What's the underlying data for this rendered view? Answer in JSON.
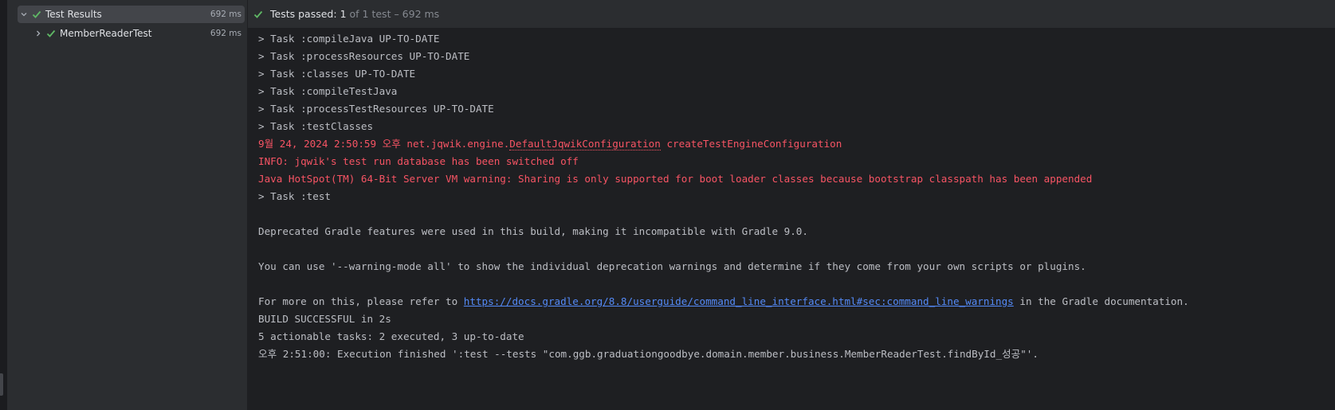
{
  "colors": {
    "pass_green": "#5fb865",
    "error_red": "#f75464",
    "link_blue": "#548af7"
  },
  "tree": {
    "root": {
      "label": "Test Results",
      "time": "692 ms",
      "icon": "check-icon",
      "expanded": true
    },
    "items": [
      {
        "label": "MemberReaderTest",
        "time": "692 ms",
        "icon": "check-icon",
        "expanded": false
      }
    ]
  },
  "status_bar": {
    "prefix": "Tests passed:",
    "passed": "1",
    "suffix": "of 1 test – 692 ms"
  },
  "console": {
    "line1": "> Task :compileJava UP-TO-DATE",
    "line2": "> Task :processResources UP-TO-DATE",
    "line3": "> Task :classes UP-TO-DATE",
    "line4": "> Task :compileTestJava",
    "line5": "> Task :processTestResources UP-TO-DATE",
    "line6": "> Task :testClasses",
    "line7_prefix": "9월 24, 2024 2:50:59 오후 net.jqwik.engine.",
    "line7_class": "DefaultJqwikConfiguration",
    "line7_suffix": " createTestEngineConfiguration",
    "line8": "INFO: jqwik's test run database has been switched off",
    "line9": "Java HotSpot(TM) 64-Bit Server VM warning: Sharing is only supported for boot loader classes because bootstrap classpath has been appended",
    "line10": "> Task :test",
    "line12": "Deprecated Gradle features were used in this build, making it incompatible with Gradle 9.0.",
    "line14": "You can use '--warning-mode all' to show the individual deprecation warnings and determine if they come from your own scripts or plugins.",
    "line16_prefix": "For more on this, please refer to ",
    "line16_link": "https://docs.gradle.org/8.8/userguide/command_line_interface.html#sec:command_line_warnings",
    "line16_suffix": " in the Gradle documentation.",
    "line17": "BUILD SUCCESSFUL in 2s",
    "line18": "5 actionable tasks: 2 executed, 3 up-to-date",
    "line19": "오후 2:51:00: Execution finished ':test --tests \"com.ggb.graduationgoodbye.domain.member.business.MemberReaderTest.findById_성공\"'."
  }
}
